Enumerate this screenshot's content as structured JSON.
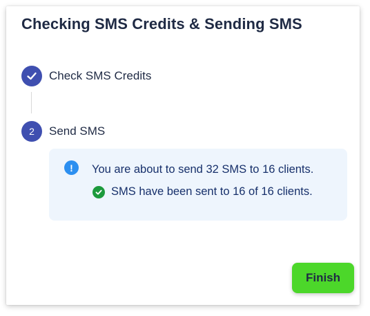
{
  "dialog": {
    "title": "Checking SMS Credits & Sending SMS"
  },
  "steps": [
    {
      "label": "Check SMS Credits",
      "status": "completed",
      "icon": "checkmark-icon"
    },
    {
      "number": "2",
      "label": "Send SMS",
      "status": "active"
    }
  ],
  "info_box": {
    "info_icon": "info-icon",
    "message": "You are about to send 32 SMS to 16 clients.",
    "success_icon": "check-circle-icon",
    "success_message": "SMS have been sent to 16 of 16 clients."
  },
  "actions": {
    "finish_label": "Finish"
  },
  "colors": {
    "step_circle": "#3f4fb0",
    "info_bg": "#eef5fd",
    "info_icon": "#2c8ff0",
    "success_icon": "#1c9a3c",
    "finish_button": "#4cd72a",
    "text_dark": "#1f2a44",
    "text_info": "#17306b"
  }
}
